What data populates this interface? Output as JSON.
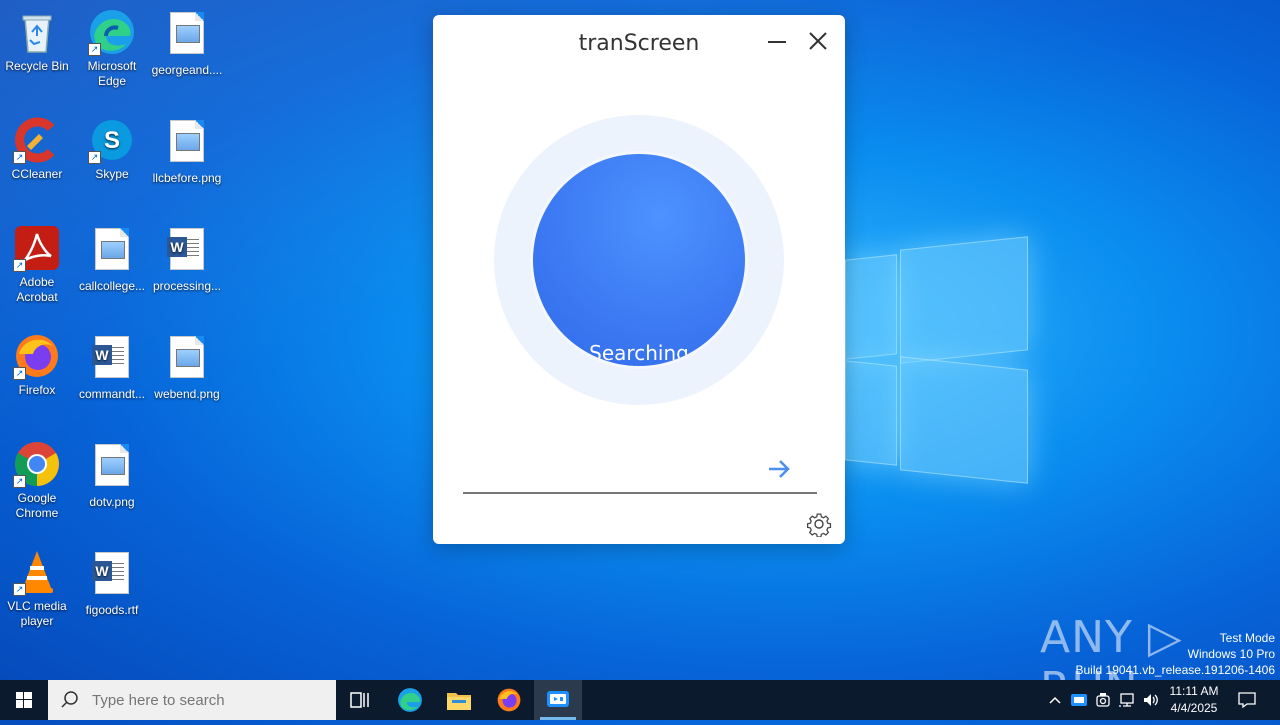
{
  "desktop": {
    "icons": [
      {
        "label": "Recycle Bin",
        "icon": "recycle-bin-icon"
      },
      {
        "label": "Microsoft Edge",
        "icon": "edge-icon"
      },
      {
        "label": "georgeand....",
        "icon": "image-file-icon"
      },
      {
        "label": "CCleaner",
        "icon": "ccleaner-icon"
      },
      {
        "label": "Skype",
        "icon": "skype-icon"
      },
      {
        "label": "llcbefore.png",
        "icon": "image-file-icon"
      },
      {
        "label": "Adobe Acrobat",
        "icon": "acrobat-icon"
      },
      {
        "label": "callcollege...",
        "icon": "image-file-icon"
      },
      {
        "label": "processing...",
        "icon": "word-file-icon"
      },
      {
        "label": "Firefox",
        "icon": "firefox-icon"
      },
      {
        "label": "commandt...",
        "icon": "word-file-icon"
      },
      {
        "label": "webend.png",
        "icon": "image-file-icon"
      },
      {
        "label": "Google Chrome",
        "icon": "chrome-icon"
      },
      {
        "label": "dotv.png",
        "icon": "image-file-icon"
      },
      {
        "label": "VLC media player",
        "icon": "vlc-icon"
      },
      {
        "label": "figoods.rtf",
        "icon": "word-file-icon"
      }
    ]
  },
  "app": {
    "title": "tranScreen",
    "status": "Searching",
    "input_value": "",
    "accent": "#3b78f2"
  },
  "watermark": {
    "brand": "ANY ▷ RUN",
    "line1": "Test Mode",
    "line2": "Windows 10 Pro",
    "line3": "Build 19041.vb_release.191206-1406"
  },
  "taskbar": {
    "search_placeholder": "Type here to search",
    "time": "11:11 AM",
    "date": "4/4/2025"
  }
}
